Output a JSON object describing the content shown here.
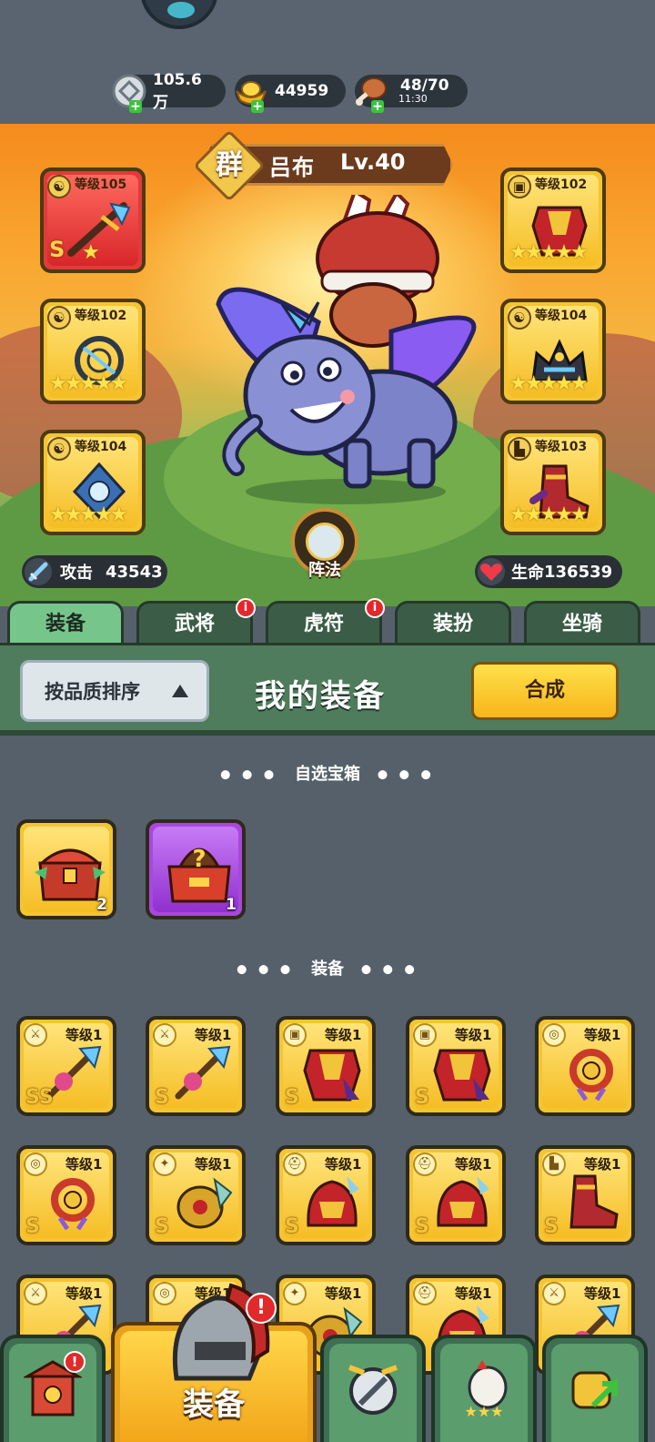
{
  "resources": {
    "silver": "105.6万",
    "gold": "44959",
    "stamina": "48/70",
    "stamina_timer": "11:30"
  },
  "hero": {
    "faction": "群",
    "name": "吕布",
    "level": "Lv.40",
    "formation_label": "阵法",
    "attack_label": "攻击",
    "attack_value": "43543",
    "hp_label": "生命",
    "hp_value": "136539"
  },
  "equipped": {
    "weapon": {
      "level": "等级105",
      "grade": "S",
      "stars": "★"
    },
    "accessory1": {
      "level": "等级102",
      "stars": "★★★★★"
    },
    "accessory2": {
      "level": "等级104",
      "stars": "★★★★★"
    },
    "armor": {
      "level": "等级102",
      "stars": "★★★★★"
    },
    "helmet": {
      "level": "等级104",
      "stars": "★★★★★"
    },
    "boots": {
      "level": "等级103",
      "stars": "★★★★★"
    }
  },
  "tabs": [
    {
      "label": "装备",
      "active": true
    },
    {
      "label": "武将",
      "badge": "i"
    },
    {
      "label": "虎符",
      "badge": "i"
    },
    {
      "label": "装扮"
    },
    {
      "label": "坐骑"
    }
  ],
  "panel": {
    "sort_label": "按品质排序",
    "title": "我的装备",
    "merge_label": "合成"
  },
  "sections": {
    "chests_title": "自选宝箱",
    "equip_title": "装备",
    "dots_left": "● ● ●",
    "dots_right": "● ● ●"
  },
  "chests": [
    {
      "count": "2",
      "color": "gold"
    },
    {
      "count": "1",
      "color": "purple"
    }
  ],
  "items": [
    {
      "level": "等级1",
      "grade": "SS",
      "icon": "weapon"
    },
    {
      "level": "等级1",
      "grade": "S",
      "icon": "weapon"
    },
    {
      "level": "等级1",
      "grade": "S",
      "icon": "armor"
    },
    {
      "level": "等级1",
      "grade": "S",
      "icon": "armor"
    },
    {
      "level": "等级1",
      "grade": "",
      "icon": "accessory"
    },
    {
      "level": "等级1",
      "grade": "S",
      "icon": "accessory"
    },
    {
      "level": "等级1",
      "grade": "S",
      "icon": "treasure"
    },
    {
      "level": "等级1",
      "grade": "S",
      "icon": "helmet"
    },
    {
      "level": "等级1",
      "grade": "S",
      "icon": "helmet"
    },
    {
      "level": "等级1",
      "grade": "S",
      "icon": "boots"
    },
    {
      "level": "等级1",
      "grade": "",
      "icon": "weapon"
    },
    {
      "level": "等级1",
      "grade": "",
      "icon": "accessory"
    },
    {
      "level": "等级1",
      "grade": "",
      "icon": "treasure"
    },
    {
      "level": "等级1",
      "grade": "",
      "icon": "helmet"
    },
    {
      "level": "等级1",
      "grade": "",
      "icon": "weapon"
    }
  ],
  "bottom_nav": {
    "equip_label": "装备",
    "badge": "!"
  },
  "colors": {
    "gold_frame": "#f5c431",
    "purple_frame": "#a847e0",
    "panel_green": "#4f7c5c",
    "badge_red": "#e22a2a"
  }
}
